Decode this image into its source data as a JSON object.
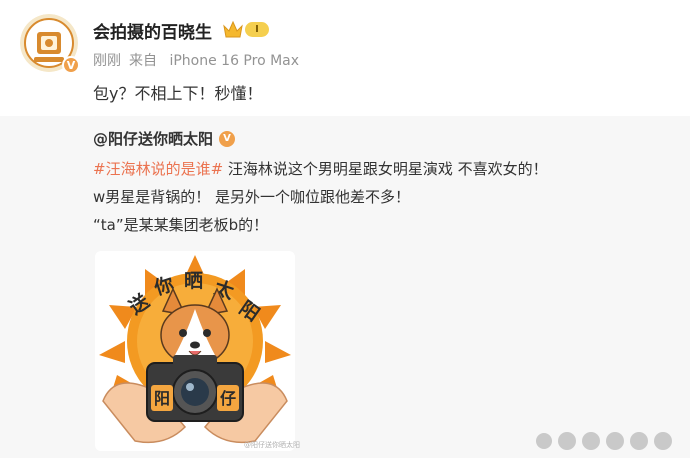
{
  "post": {
    "username": "会拍摄的百晓生",
    "level_badge": "I",
    "time": "刚刚",
    "source_prefix": "来自",
    "source_device": "iPhone 16 Pro Max",
    "text": "包y？不相上下！秒懂！",
    "avatar_verified": "V"
  },
  "repost": {
    "author": "@阳仔送你晒太阳",
    "verified_badge": "V",
    "hashtag": "#汪海林说的是谁#",
    "line1_rest": " 汪海林说这个男明星跟女明星演戏 不喜欢女的！",
    "line2": "w男星是背锅的！ 是另外一个咖位跟他差不多！",
    "line3": "“ta”是某某集团老板b的！",
    "image": {
      "banner_text": [
        "送",
        "你",
        "晒",
        "太",
        "阳"
      ],
      "camera_text": [
        "阳",
        "仔"
      ],
      "watermark": "@阳仔送你晒太阳"
    }
  },
  "colors": {
    "hashtag": "#eb7350",
    "badge": "#f0a04b",
    "meta": "#939393",
    "card_bg": "#f7f7f7"
  }
}
